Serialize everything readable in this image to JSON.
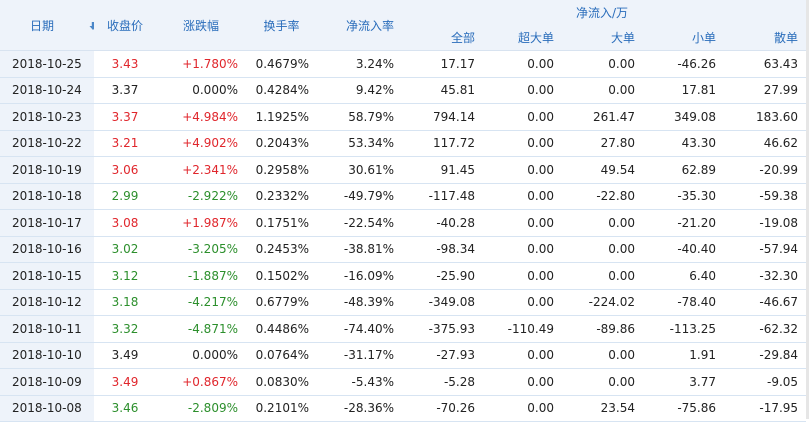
{
  "header": {
    "date": "日期",
    "close": "收盘价",
    "change": "涨跌幅",
    "turnover": "换手率",
    "net_rate": "净流入率",
    "net_group": "净流入/万",
    "total": "全部",
    "super_large": "超大单",
    "large": "大单",
    "small": "小单",
    "retail": "散单"
  },
  "colors": {
    "up": "#e0262c",
    "down": "#2c8f2c",
    "flat": "#222222",
    "header_text": "#2a6dbb",
    "header_bg": "#eef3fa"
  },
  "rows": [
    {
      "date": "2018-10-25",
      "close": "3.43",
      "change": "+1.780%",
      "dir": "up",
      "turnover": "0.4679%",
      "net_rate": "3.24%",
      "total": "17.17",
      "super_large": "0.00",
      "large": "0.00",
      "small": "-46.26",
      "retail": "63.43"
    },
    {
      "date": "2018-10-24",
      "close": "3.37",
      "change": "0.000%",
      "dir": "flat",
      "turnover": "0.4284%",
      "net_rate": "9.42%",
      "total": "45.81",
      "super_large": "0.00",
      "large": "0.00",
      "small": "17.81",
      "retail": "27.99"
    },
    {
      "date": "2018-10-23",
      "close": "3.37",
      "change": "+4.984%",
      "dir": "up",
      "turnover": "1.1925%",
      "net_rate": "58.79%",
      "total": "794.14",
      "super_large": "0.00",
      "large": "261.47",
      "small": "349.08",
      "retail": "183.60"
    },
    {
      "date": "2018-10-22",
      "close": "3.21",
      "change": "+4.902%",
      "dir": "up",
      "turnover": "0.2043%",
      "net_rate": "53.34%",
      "total": "117.72",
      "super_large": "0.00",
      "large": "27.80",
      "small": "43.30",
      "retail": "46.62"
    },
    {
      "date": "2018-10-19",
      "close": "3.06",
      "change": "+2.341%",
      "dir": "up",
      "turnover": "0.2958%",
      "net_rate": "30.61%",
      "total": "91.45",
      "super_large": "0.00",
      "large": "49.54",
      "small": "62.89",
      "retail": "-20.99"
    },
    {
      "date": "2018-10-18",
      "close": "2.99",
      "change": "-2.922%",
      "dir": "down",
      "turnover": "0.2332%",
      "net_rate": "-49.79%",
      "total": "-117.48",
      "super_large": "0.00",
      "large": "-22.80",
      "small": "-35.30",
      "retail": "-59.38"
    },
    {
      "date": "2018-10-17",
      "close": "3.08",
      "change": "+1.987%",
      "dir": "up",
      "turnover": "0.1751%",
      "net_rate": "-22.54%",
      "total": "-40.28",
      "super_large": "0.00",
      "large": "0.00",
      "small": "-21.20",
      "retail": "-19.08"
    },
    {
      "date": "2018-10-16",
      "close": "3.02",
      "change": "-3.205%",
      "dir": "down",
      "turnover": "0.2453%",
      "net_rate": "-38.81%",
      "total": "-98.34",
      "super_large": "0.00",
      "large": "0.00",
      "small": "-40.40",
      "retail": "-57.94"
    },
    {
      "date": "2018-10-15",
      "close": "3.12",
      "change": "-1.887%",
      "dir": "down",
      "turnover": "0.1502%",
      "net_rate": "-16.09%",
      "total": "-25.90",
      "super_large": "0.00",
      "large": "0.00",
      "small": "6.40",
      "retail": "-32.30"
    },
    {
      "date": "2018-10-12",
      "close": "3.18",
      "change": "-4.217%",
      "dir": "down",
      "turnover": "0.6779%",
      "net_rate": "-48.39%",
      "total": "-349.08",
      "super_large": "0.00",
      "large": "-224.02",
      "small": "-78.40",
      "retail": "-46.67"
    },
    {
      "date": "2018-10-11",
      "close": "3.32",
      "change": "-4.871%",
      "dir": "down",
      "turnover": "0.4486%",
      "net_rate": "-74.40%",
      "total": "-375.93",
      "super_large": "-110.49",
      "large": "-89.86",
      "small": "-113.25",
      "retail": "-62.32"
    },
    {
      "date": "2018-10-10",
      "close": "3.49",
      "change": "0.000%",
      "dir": "flat",
      "turnover": "0.0764%",
      "net_rate": "-31.17%",
      "total": "-27.93",
      "super_large": "0.00",
      "large": "0.00",
      "small": "1.91",
      "retail": "-29.84"
    },
    {
      "date": "2018-10-09",
      "close": "3.49",
      "change": "+0.867%",
      "dir": "up",
      "turnover": "0.0830%",
      "net_rate": "-5.43%",
      "total": "-5.28",
      "super_large": "0.00",
      "large": "0.00",
      "small": "3.77",
      "retail": "-9.05"
    },
    {
      "date": "2018-10-08",
      "close": "3.46",
      "change": "-2.809%",
      "dir": "down",
      "turnover": "0.2101%",
      "net_rate": "-28.36%",
      "total": "-70.26",
      "super_large": "0.00",
      "large": "23.54",
      "small": "-75.86",
      "retail": "-17.95"
    }
  ]
}
